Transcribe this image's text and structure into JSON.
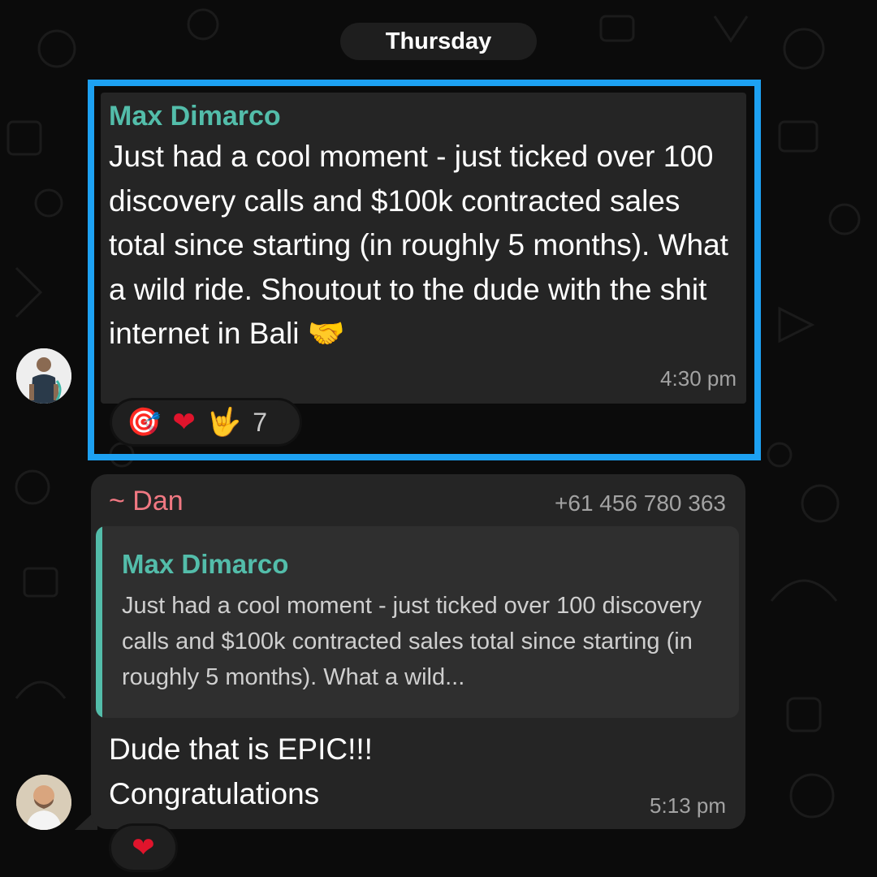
{
  "date_separator": "Thursday",
  "colors": {
    "highlight_border": "#1da1f2",
    "sender_green": "#53bdaa",
    "sender_pink": "#f07882",
    "bubble": "#252525"
  },
  "messages": [
    {
      "sender": "Max Dimarco",
      "text": "Just had a cool moment - just ticked over 100 discovery calls and $100k contracted sales total since starting (in roughly 5 months). What a wild ride. Shoutout to the dude with the shit internet in Bali 🤝",
      "time": "4:30 pm",
      "reactions": {
        "emojis": [
          "🎯",
          "❤",
          "🤟"
        ],
        "count": "7"
      },
      "avatar_icon": "avatar-photo"
    },
    {
      "sender": "~ Dan",
      "phone": "+61 456 780 363",
      "quoted": {
        "sender": "Max Dimarco",
        "text": "Just had a cool moment - just ticked over 100 discovery calls and $100k contracted sales total since starting (in roughly 5 months). What a wild..."
      },
      "text_line1": "Dude that is EPIC!!!",
      "text_line2": "Congratulations",
      "time": "5:13 pm",
      "reactions": {
        "emojis": [
          "❤"
        ]
      },
      "avatar_icon": "avatar-photo"
    }
  ]
}
